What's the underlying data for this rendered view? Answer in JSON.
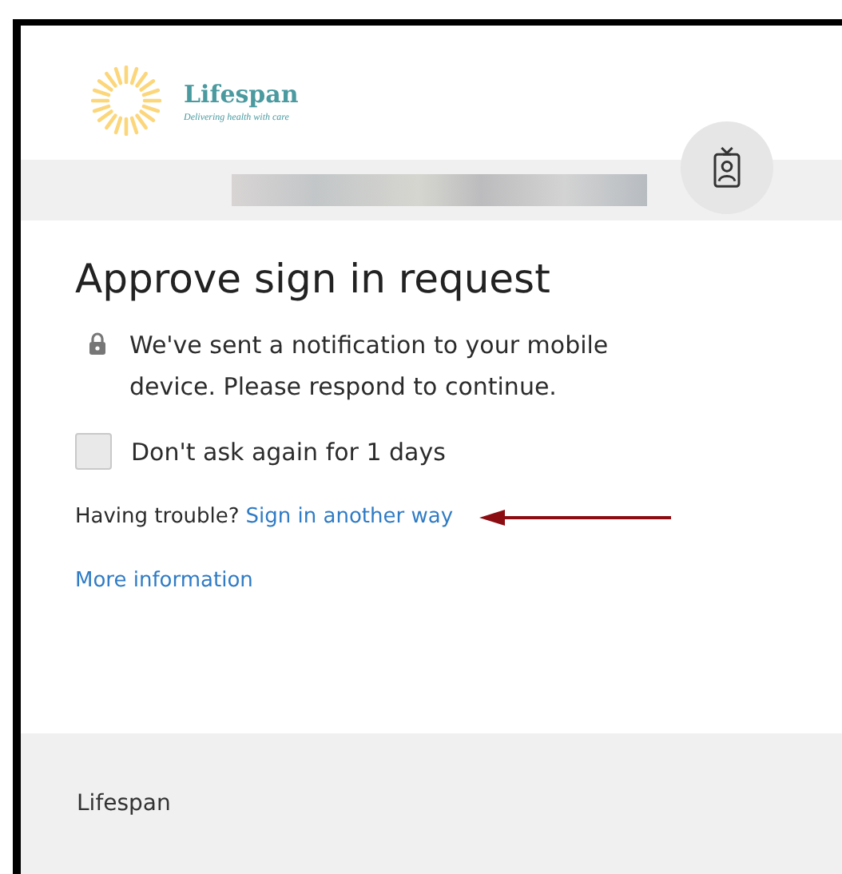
{
  "brand": {
    "name": "Lifespan",
    "tagline": "Delivering health with care"
  },
  "identity": {
    "redacted": true
  },
  "title": "Approve sign in request",
  "message": "We've sent a notification to your mobile device. Please respond to continue.",
  "remember": {
    "label": "Don't ask again for 1 days",
    "checked": false
  },
  "trouble": {
    "text": "Having trouble?",
    "link": "Sign in another way"
  },
  "more_link": "More information",
  "footer": {
    "text": "Lifespan"
  }
}
